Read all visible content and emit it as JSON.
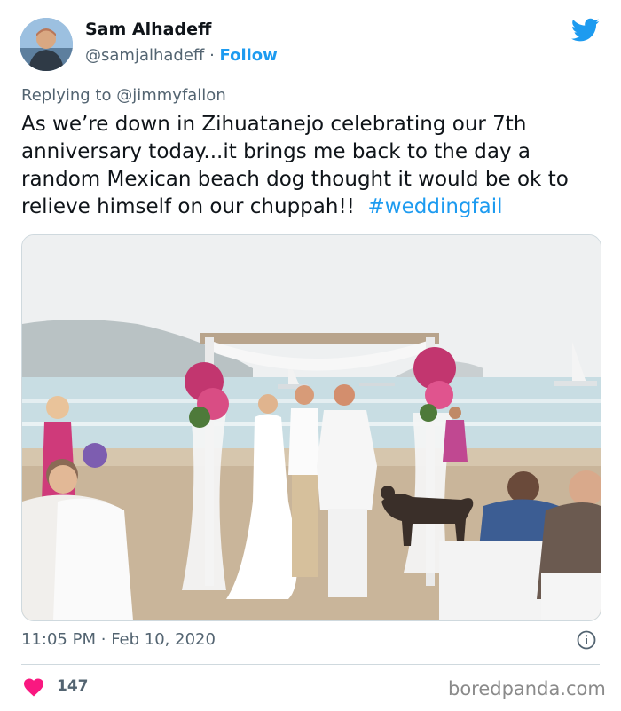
{
  "author": {
    "name": "Sam Alhadeff",
    "handle": "@samjalhadeff",
    "separator": "·",
    "follow_label": "Follow"
  },
  "reply": {
    "prefix": "Replying to",
    "mention": "@jimmyfallon"
  },
  "tweet": {
    "text": "As we’re down in Zihuatanejo celebrating our 7th anniversary today...it brings me back to the day a random Mexican beach dog thought it would be ok to relieve himself on our chuppah!!",
    "hashtag": "#weddingfail"
  },
  "timestamp": {
    "time": "11:05 PM",
    "separator": "·",
    "date": "Feb 10, 2020"
  },
  "engagement": {
    "likes": "147"
  },
  "watermark": "boredpanda.com",
  "colors": {
    "accent": "#1d9bf0",
    "heart": "#f91880",
    "secondary_text": "#536471"
  },
  "icons": [
    "twitter-bird-icon",
    "info-icon",
    "heart-icon"
  ]
}
